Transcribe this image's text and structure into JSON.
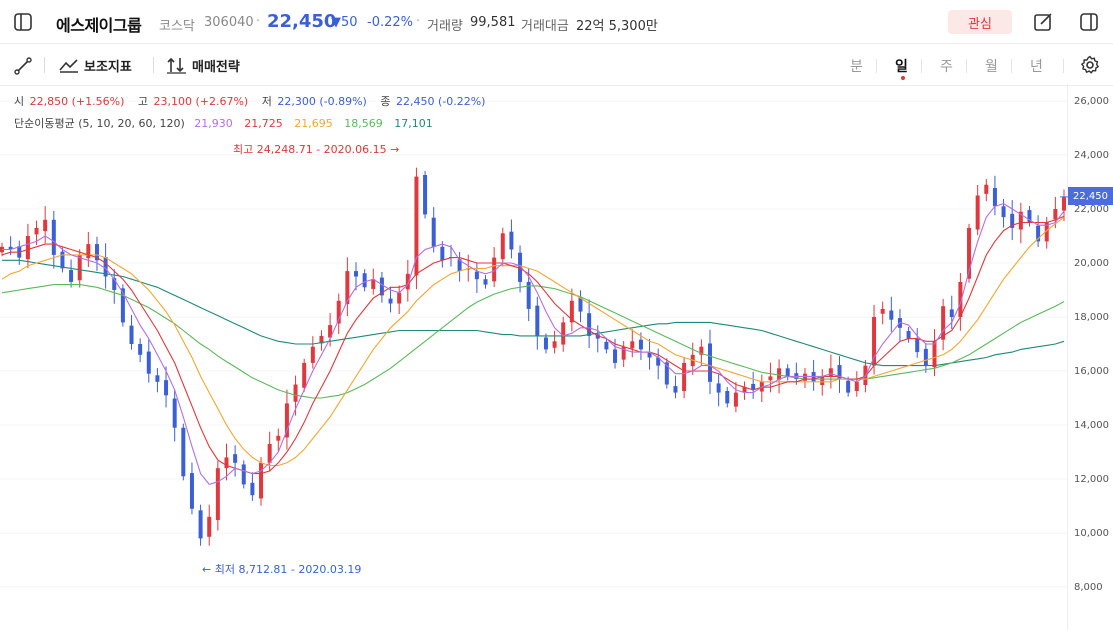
{
  "header": {
    "stock_name": "에스제이그룹",
    "market": "코스닥",
    "code": "306040",
    "price": "22,450",
    "change": "▼50",
    "rate": "-0.22%",
    "volume_label": "거래량",
    "volume": "99,581",
    "amount_label": "거래대금",
    "amount": "22억 5,300만",
    "favorite_label": "관심"
  },
  "toolbar": {
    "indicator_label": "보조지표",
    "strategy_label": "매매전략",
    "periods": [
      "분",
      "일",
      "주",
      "월",
      "년"
    ],
    "active_period": "일"
  },
  "ohlc": {
    "open_label": "시",
    "open": "22,850 (+1.56%)",
    "high_label": "고",
    "high": "23,100 (+2.67%)",
    "low_label": "저",
    "low": "22,300 (-0.89%)",
    "close_label": "종",
    "close": "22,450 (-0.22%)"
  },
  "ma": {
    "label": "단순이동평균 (5, 10, 20, 60, 120)",
    "values": [
      "21,930",
      "21,725",
      "21,695",
      "18,569",
      "17,101"
    ],
    "colors": [
      "#b56fe0",
      "#e0383e",
      "#f0a830",
      "#5cb85c",
      "#1f8a7a"
    ]
  },
  "annotations": {
    "high": "최고 24,248.71 - 2020.06.15 →",
    "low": "← 최저 8,712.81 - 2020.03.19"
  },
  "colors": {
    "up": "#e0383e",
    "down": "#3b5fd6",
    "accent": "#4a6cdc"
  },
  "chart_data": {
    "type": "line",
    "ylim": [
      7000,
      26500
    ],
    "yticks": [
      "26,000",
      "24,000",
      "22,000",
      "20,000",
      "18,000",
      "16,000",
      "14,000",
      "12,000",
      "10,000",
      "8,000"
    ],
    "ytick_values": [
      26000,
      24000,
      22000,
      20000,
      18000,
      16000,
      14000,
      12000,
      10000,
      8000
    ],
    "current_price_label": "22,450",
    "current_price": 22450,
    "close_series": [
      20600,
      20500,
      20200,
      21000,
      21300,
      21600,
      20300,
      19800,
      19300,
      20300,
      20700,
      20100,
      19500,
      19000,
      17800,
      17000,
      16600,
      15900,
      15600,
      15100,
      13900,
      12100,
      10900,
      9800,
      10600,
      12400,
      12800,
      12600,
      11800,
      11400,
      12600,
      13300,
      13600,
      14800,
      15500,
      16300,
      16900,
      17300,
      17700,
      18600,
      19700,
      19500,
      19100,
      19400,
      18800,
      18500,
      18900,
      19600,
      23200,
      21800,
      20600,
      20100,
      20200,
      19700,
      19800,
      19400,
      19200,
      20200,
      21100,
      20500,
      19300,
      18300,
      17300,
      16800,
      17100,
      17800,
      18600,
      18200,
      17300,
      17200,
      16800,
      16300,
      16900,
      17100,
      16800,
      16500,
      16200,
      15500,
      15200,
      16300,
      16600,
      16900,
      15600,
      15200,
      14800,
      15200,
      15400,
      15300,
      15600,
      15800,
      16100,
      15800,
      15700,
      15900,
      15600,
      15800,
      16100,
      15700,
      15200,
      15600,
      16200,
      18000,
      18300,
      17900,
      17600,
      17200,
      16700,
      16200,
      17100,
      18400,
      18000,
      19300,
      21300,
      22500,
      22900,
      22100,
      21700,
      21300,
      21900,
      21500,
      20800,
      21500,
      22000,
      22450
    ],
    "ma5": [
      20500,
      20500,
      20600,
      20700,
      20800,
      21000,
      20800,
      20500,
      20300,
      20200,
      20100,
      20000,
      19800,
      19400,
      18900,
      18300,
      17700,
      17200,
      16600,
      16000,
      15300,
      14300,
      13200,
      12200,
      11800,
      11900,
      12100,
      12400,
      12300,
      12200,
      12300,
      12600,
      13000,
      13800,
      14600,
      15300,
      16000,
      16600,
      17200,
      17900,
      18600,
      19100,
      19300,
      19400,
      19200,
      19000,
      18900,
      19200,
      20200,
      20500,
      20600,
      20700,
      20600,
      20100,
      19900,
      19700,
      19600,
      19700,
      20000,
      20000,
      19900,
      19500,
      18900,
      18200,
      17600,
      17300,
      17400,
      17600,
      17600,
      17500,
      17200,
      16900,
      16800,
      16700,
      16700,
      16700,
      16500,
      16200,
      15900,
      15900,
      16000,
      16200,
      16200,
      16000,
      15600,
      15300,
      15200,
      15200,
      15400,
      15500,
      15700,
      15800,
      15800,
      15800,
      15800,
      15800,
      15900,
      15800,
      15700,
      15600,
      15800,
      16500,
      17000,
      17400,
      17800,
      17700,
      17300,
      17000,
      17000,
      17500,
      17800,
      18500,
      19700,
      20800,
      21700,
      22100,
      22200,
      22000,
      21800,
      21600,
      21400,
      21400,
      21500,
      21930
    ],
    "ma10": [
      20300,
      20400,
      20400,
      20500,
      20600,
      20700,
      20700,
      20600,
      20500,
      20400,
      20300,
      20200,
      20000,
      19700,
      19400,
      19000,
      18500,
      18000,
      17500,
      16900,
      16300,
      15500,
      14700,
      13900,
      13200,
      12700,
      12500,
      12400,
      12300,
      12200,
      12200,
      12300,
      12600,
      13000,
      13500,
      14100,
      14800,
      15400,
      16000,
      16700,
      17400,
      17900,
      18300,
      18700,
      18900,
      19100,
      19100,
      19200,
      19600,
      19800,
      20000,
      20100,
      20200,
      20200,
      20100,
      20000,
      20000,
      20000,
      20000,
      19900,
      19800,
      19600,
      19300,
      18900,
      18500,
      18200,
      17900,
      17700,
      17500,
      17300,
      17200,
      17000,
      16900,
      16800,
      16700,
      16700,
      16600,
      16400,
      16200,
      16000,
      16000,
      16000,
      16000,
      15900,
      15700,
      15500,
      15400,
      15300,
      15400,
      15400,
      15500,
      15600,
      15600,
      15700,
      15700,
      15800,
      15800,
      15800,
      15700,
      15700,
      15800,
      16200,
      16500,
      16800,
      17100,
      17200,
      17200,
      17100,
      17100,
      17300,
      17500,
      18000,
      18700,
      19500,
      20300,
      20800,
      21200,
      21400,
      21500,
      21500,
      21500,
      21500,
      21600,
      21725
    ],
    "ma20": [
      19400,
      19600,
      19700,
      19900,
      20000,
      20100,
      20200,
      20300,
      20300,
      20300,
      20300,
      20300,
      20200,
      20000,
      19800,
      19600,
      19300,
      19000,
      18600,
      18200,
      17700,
      17100,
      16500,
      15800,
      15200,
      14600,
      14000,
      13500,
      13100,
      12800,
      12600,
      12500,
      12500,
      12600,
      12800,
      13100,
      13500,
      13900,
      14300,
      14800,
      15300,
      15800,
      16300,
      16800,
      17200,
      17600,
      17900,
      18200,
      18600,
      18900,
      19200,
      19400,
      19600,
      19700,
      19800,
      19800,
      19800,
      19900,
      19900,
      19900,
      19900,
      19800,
      19700,
      19500,
      19300,
      19100,
      18900,
      18700,
      18500,
      18300,
      18100,
      17900,
      17700,
      17500,
      17300,
      17100,
      17000,
      16800,
      16600,
      16500,
      16400,
      16300,
      16200,
      16100,
      16000,
      15900,
      15800,
      15700,
      15600,
      15600,
      15600,
      15600,
      15600,
      15600,
      15600,
      15600,
      15600,
      15700,
      15700,
      15700,
      15700,
      15800,
      15900,
      16000,
      16100,
      16200,
      16300,
      16400,
      16500,
      16600,
      16800,
      17100,
      17500,
      17900,
      18400,
      18900,
      19400,
      19800,
      20200,
      20600,
      20900,
      21200,
      21450,
      21695
    ],
    "ma60": [
      18900,
      18950,
      19000,
      19050,
      19100,
      19150,
      19200,
      19200,
      19200,
      19200,
      19150,
      19100,
      19000,
      18900,
      18800,
      18650,
      18500,
      18350,
      18150,
      17950,
      17750,
      17500,
      17250,
      17000,
      16800,
      16550,
      16350,
      16150,
      15950,
      15750,
      15600,
      15450,
      15300,
      15200,
      15100,
      15050,
      15000,
      15000,
      15050,
      15100,
      15200,
      15350,
      15500,
      15700,
      15900,
      16100,
      16350,
      16600,
      16850,
      17100,
      17350,
      17600,
      17850,
      18100,
      18350,
      18550,
      18700,
      18850,
      18950,
      19050,
      19100,
      19150,
      19150,
      19100,
      19050,
      18950,
      18850,
      18750,
      18600,
      18450,
      18300,
      18150,
      18000,
      17850,
      17700,
      17550,
      17400,
      17250,
      17100,
      16950,
      16800,
      16650,
      16550,
      16450,
      16350,
      16250,
      16150,
      16050,
      15950,
      15900,
      15850,
      15800,
      15750,
      15700,
      15700,
      15700,
      15700,
      15700,
      15700,
      15700,
      15700,
      15750,
      15800,
      15850,
      15900,
      15950,
      16000,
      16050,
      16100,
      16200,
      16300,
      16450,
      16600,
      16800,
      17000,
      17200,
      17400,
      17600,
      17800,
      17950,
      18100,
      18250,
      18400,
      18569
    ],
    "ma120": [
      20100,
      20100,
      20100,
      20050,
      20000,
      19950,
      19900,
      19850,
      19800,
      19750,
      19700,
      19650,
      19600,
      19550,
      19500,
      19400,
      19300,
      19200,
      19100,
      18950,
      18800,
      18650,
      18500,
      18350,
      18200,
      18050,
      17900,
      17750,
      17600,
      17450,
      17300,
      17200,
      17100,
      17050,
      17000,
      17000,
      17000,
      17050,
      17100,
      17150,
      17200,
      17250,
      17300,
      17350,
      17400,
      17450,
      17500,
      17500,
      17500,
      17500,
      17500,
      17500,
      17500,
      17500,
      17500,
      17500,
      17450,
      17400,
      17350,
      17350,
      17300,
      17300,
      17300,
      17300,
      17300,
      17300,
      17300,
      17300,
      17350,
      17400,
      17450,
      17500,
      17550,
      17600,
      17650,
      17700,
      17750,
      17750,
      17800,
      17800,
      17800,
      17800,
      17800,
      17750,
      17700,
      17650,
      17600,
      17550,
      17500,
      17400,
      17300,
      17200,
      17100,
      17000,
      16900,
      16800,
      16700,
      16600,
      16500,
      16400,
      16300,
      16250,
      16200,
      16200,
      16200,
      16200,
      16200,
      16200,
      16200,
      16250,
      16300,
      16350,
      16400,
      16450,
      16500,
      16600,
      16650,
      16700,
      16800,
      16850,
      16900,
      16950,
      17000,
      17101
    ]
  }
}
